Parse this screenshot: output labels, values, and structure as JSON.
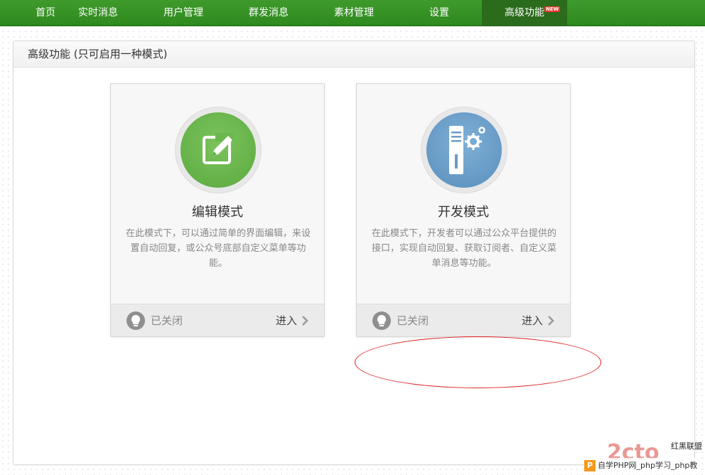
{
  "nav": {
    "items": [
      {
        "label": "首页"
      },
      {
        "label": "实时消息"
      },
      {
        "label": "用户管理"
      },
      {
        "label": "群发消息"
      },
      {
        "label": "素材管理"
      },
      {
        "label": "设置"
      },
      {
        "label": "高级功能",
        "badge": "NEW",
        "active": true
      }
    ]
  },
  "panel": {
    "title": "高级功能 (只可启用一种模式)"
  },
  "cards": {
    "edit": {
      "icon": "edit-pencil-icon",
      "title": "编辑模式",
      "desc": "在此模式下，可以通过简单的界面编辑，来设置自动回复，或公众号底部自定义菜单等功能。",
      "status": "已关闭",
      "action": "进入"
    },
    "dev": {
      "icon": "server-gear-icon",
      "title": "开发模式",
      "desc": "在此模式下，开发者可以通过公众平台提供的接口，实现自动回复、获取订阅者、自定义菜单消息等功能。",
      "status": "已关闭",
      "action": "进入"
    }
  },
  "watermark": {
    "logo": "2cto",
    "logo_sub": "红黑联盟",
    "text": "自学PHP网_php学习_php教"
  },
  "colors": {
    "nav_bg": "#3f9a2c",
    "nav_active": "#2b6b1c",
    "edit_icon": "#5aaa3f",
    "dev_icon": "#5a8fbd",
    "annotation": "#dd2222"
  }
}
